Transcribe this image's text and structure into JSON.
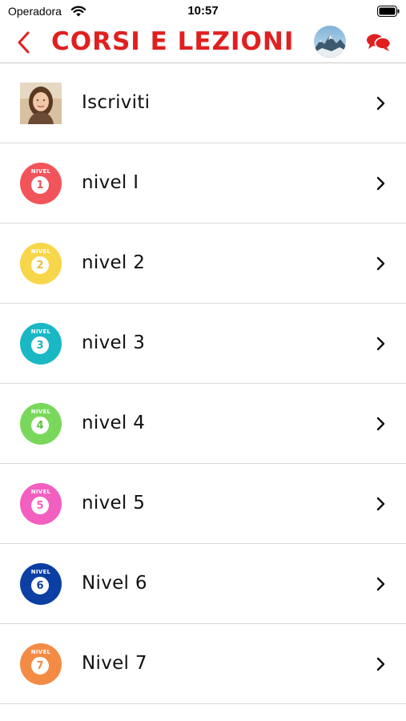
{
  "status_bar": {
    "carrier": "Operadora",
    "time": "10:57"
  },
  "nav": {
    "title": "CORSI E LEZIONI",
    "accent_color": "#e02020"
  },
  "list": {
    "items": [
      {
        "label": "Iscriviti",
        "kind": "photo"
      },
      {
        "label": "nivel I",
        "kind": "level",
        "badge_text": "NIVEL",
        "badge_number": "1",
        "color": "#f2545b"
      },
      {
        "label": "nivel 2",
        "kind": "level",
        "badge_text": "NIVEL",
        "badge_number": "2",
        "color": "#f7d64a"
      },
      {
        "label": "nivel 3",
        "kind": "level",
        "badge_text": "NIVEL",
        "badge_number": "3",
        "color": "#19b8c4"
      },
      {
        "label": "nivel 4",
        "kind": "level",
        "badge_text": "NIVEL",
        "badge_number": "4",
        "color": "#79d85b"
      },
      {
        "label": "nivel 5",
        "kind": "level",
        "badge_text": "NIVEL",
        "badge_number": "5",
        "color": "#f25fbf"
      },
      {
        "label": "Nivel 6",
        "kind": "level",
        "badge_text": "NIVEL",
        "badge_number": "6",
        "color": "#0c3fa3"
      },
      {
        "label": "Nivel 7",
        "kind": "level",
        "badge_text": "NIVEL",
        "badge_number": "7",
        "color": "#f48b45"
      }
    ]
  }
}
